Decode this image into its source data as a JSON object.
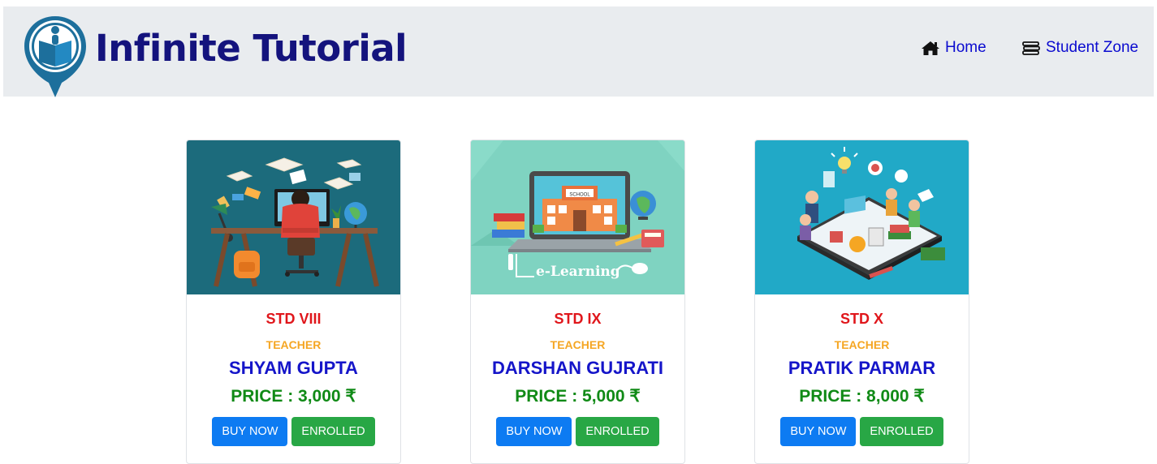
{
  "brand": {
    "name": "Infinite Tutorial"
  },
  "nav": {
    "home_label": "Home",
    "student_zone_label": "Student Zone"
  },
  "courses": [
    {
      "std": "STD VIII",
      "role": "TEACHER",
      "teacher": "SHYAM GUPTA",
      "price": "PRICE : 3,000 ₹",
      "buy": "BUY NOW",
      "status": "ENROLLED",
      "image": "student-studying-illustration"
    },
    {
      "std": "STD IX",
      "role": "TEACHER",
      "teacher": "DARSHAN GUJRATI",
      "price": "PRICE : 5,000 ₹",
      "buy": "BUY NOW",
      "status": "ENROLLED",
      "image": "e-learning-laptop-illustration",
      "image_text": "e-Learning",
      "image_sign": "SCHOOL"
    },
    {
      "std": "STD X",
      "role": "TEACHER",
      "teacher": "PRATIK PARMAR",
      "price": "PRICE : 8,000 ₹",
      "buy": "BUY NOW",
      "status": "ENROLLED",
      "image": "online-education-tablet-illustration"
    }
  ],
  "colors": {
    "navbar_bg": "#e9ecef",
    "brand": "#14137d",
    "nav_link": "#0a0acf",
    "std": "#e0161b",
    "role": "#f5a623",
    "teacher": "#1515c9",
    "price": "#108a16",
    "buy_button": "#0d7bf2",
    "enrolled_button": "#28a745"
  }
}
